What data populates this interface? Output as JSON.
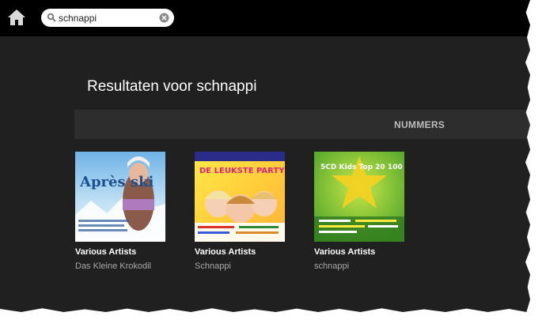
{
  "header": {
    "search": {
      "value": "schnappi",
      "placeholder": ""
    },
    "icons": [
      "home-icon",
      "search-icon",
      "clear-icon"
    ]
  },
  "main": {
    "title": "Resultaten voor schnappi",
    "tabs": [
      {
        "label": "NUMMERS"
      }
    ],
    "albums": [
      {
        "artist": "Various Artists",
        "title": "Das Kleine Krokodil",
        "cover_text": "Après ski"
      },
      {
        "artist": "Various Artists",
        "title": "Schnappi",
        "cover_text": "DE LEUKSTE PARTY HITS"
      },
      {
        "artist": "Various Artists",
        "title": "schnappi",
        "cover_text": "5CD Kids Top 20 100 BOX"
      }
    ]
  },
  "colors": {
    "topbar": "#000000",
    "background": "#202020",
    "tabbar": "#2d2d2d",
    "text": "#ffffff",
    "muted": "#a8a8a8"
  }
}
